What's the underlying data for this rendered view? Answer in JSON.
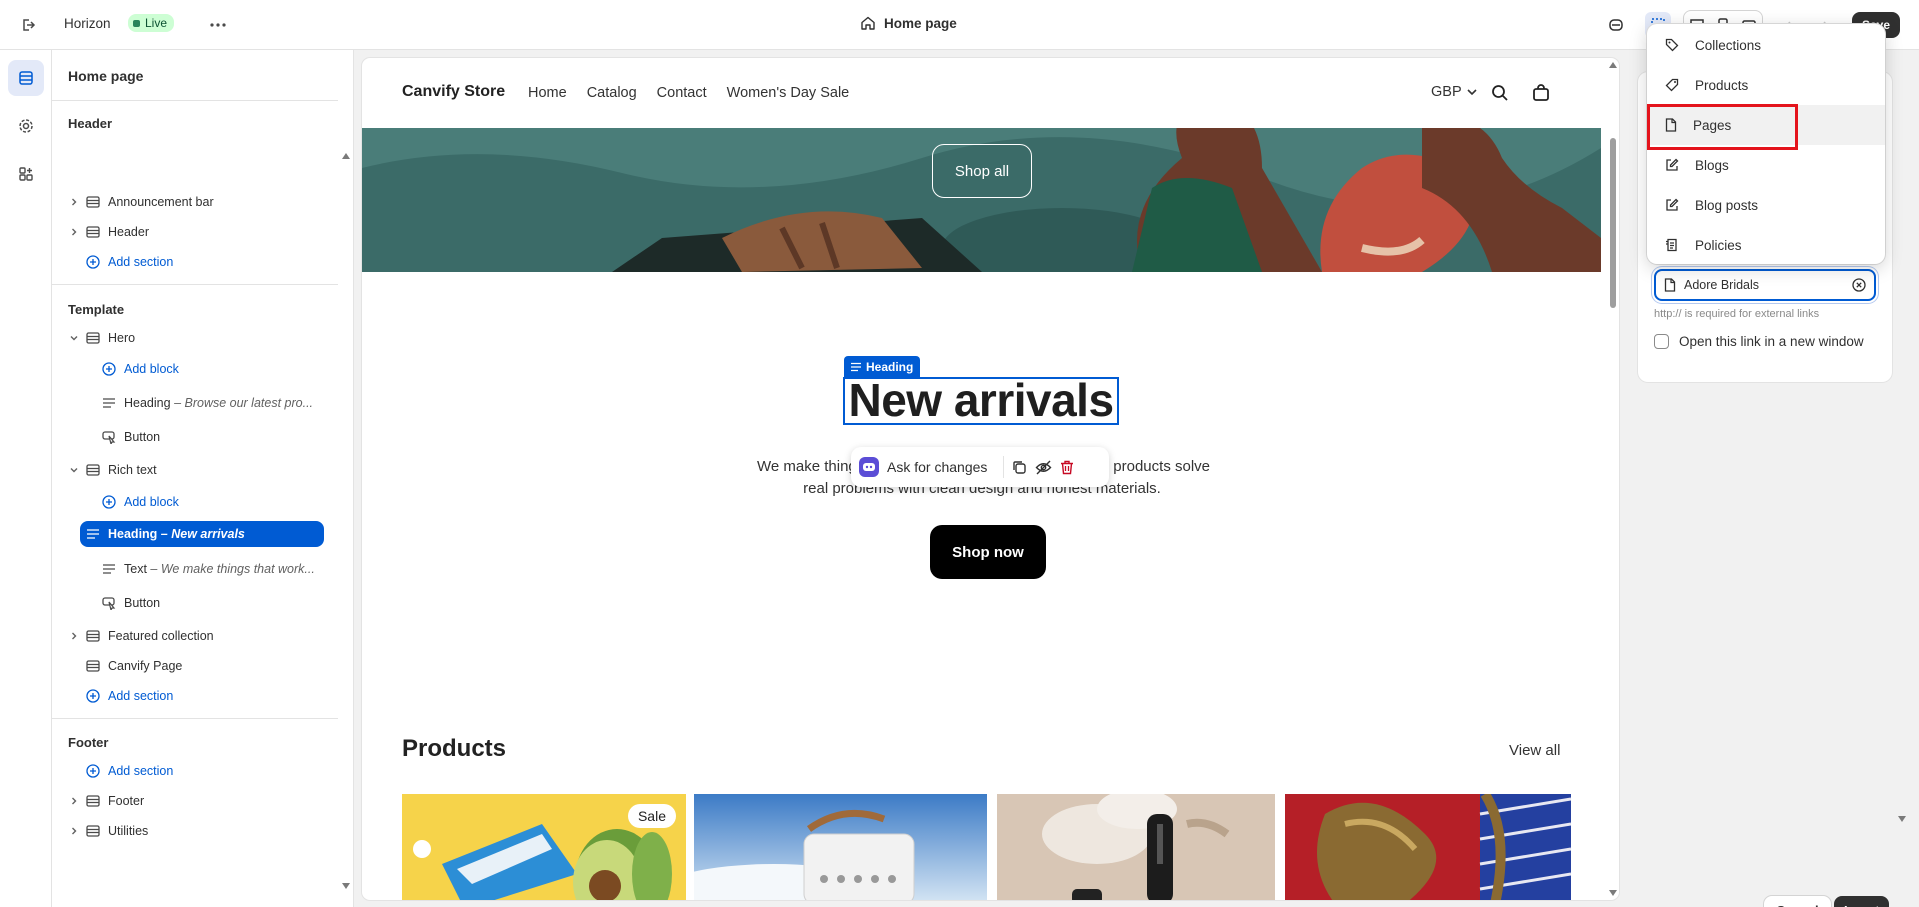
{
  "topbar": {
    "theme_name": "Horizon",
    "live_label": "Live",
    "page_label": "Home page",
    "save_label": "Save"
  },
  "sidebar": {
    "title": "Home page",
    "header_group": "Header",
    "header_items": [
      "Announcement bar",
      "Header"
    ],
    "add_section": "Add section",
    "template_group": "Template",
    "hero": "Hero",
    "add_block": "Add block",
    "hero_heading": "Heading",
    "hero_heading_sub": "– Browse our latest pro...",
    "button": "Button",
    "rich_text": "Rich text",
    "rt_heading": "Heading",
    "rt_heading_sub": "– New arrivals",
    "rt_text": "Text",
    "rt_text_sub": "– We make things that work...",
    "featured_collection": "Featured collection",
    "canvify_page": "Canvify Page",
    "footer_group": "Footer",
    "footer": "Footer",
    "utilities": "Utilities"
  },
  "store": {
    "name": "Canvify Store",
    "nav": [
      "Home",
      "Catalog",
      "Contact",
      "Women's Day Sale"
    ],
    "currency": "GBP",
    "shop_all": "Shop all",
    "heading_chip": "Heading",
    "heading": "New arrivals",
    "body_line1_left": "We make thing",
    "body_line1_right": "products solve",
    "body_line2": "real problems with clean design and honest materials.",
    "ask_for_changes": "Ask for changes",
    "shop_now": "Shop now",
    "products_title": "Products",
    "view_all": "View all",
    "sale_badge": "Sale"
  },
  "link_picker": {
    "options": [
      "Collections",
      "Products",
      "Pages",
      "Blogs",
      "Blog posts",
      "Policies"
    ],
    "input_value": "Adore Bridals",
    "help_text": "http:// is required for external links",
    "new_window_label": "Open this link in a new window",
    "cancel_label": "Cancel",
    "insert_label": "Insert"
  },
  "colors": {
    "accent": "#005bd3",
    "highlight_red": "#e4141c",
    "live_green": "#29845a",
    "hero_teal": "#3b6b68"
  }
}
